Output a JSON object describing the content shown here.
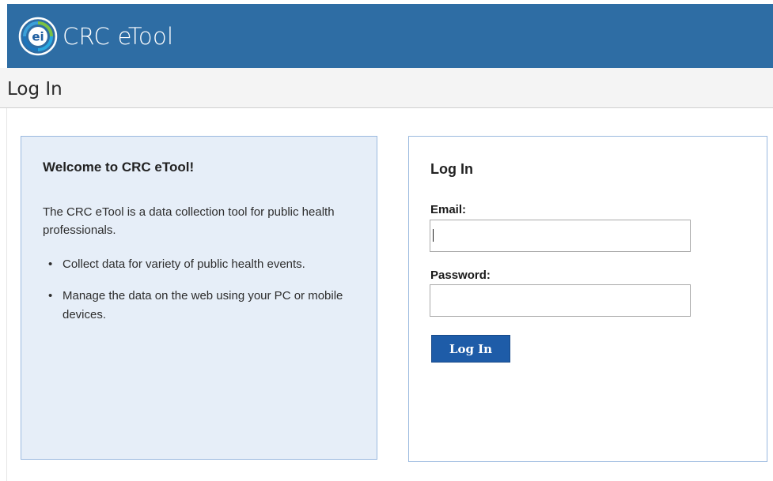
{
  "app": {
    "title": "CRC eTool",
    "logo_text": "ei",
    "brand_color": "#2e6da4"
  },
  "page": {
    "title": "Log In"
  },
  "welcome": {
    "title": "Welcome to CRC eTool!",
    "description": "The CRC eTool is a data collection tool for public health professionals.",
    "features": [
      "Collect data for variety of public health events.",
      "Manage the data on the web using your PC or mobile devices."
    ]
  },
  "login": {
    "title": "Log In",
    "email_label": "Email:",
    "email_value": "",
    "password_label": "Password:",
    "password_value": "",
    "submit_label": "Log In",
    "button_color": "#1e5ca8"
  },
  "icons": {
    "logo": "ei-logo-icon",
    "bullet": "bullet-dot"
  }
}
